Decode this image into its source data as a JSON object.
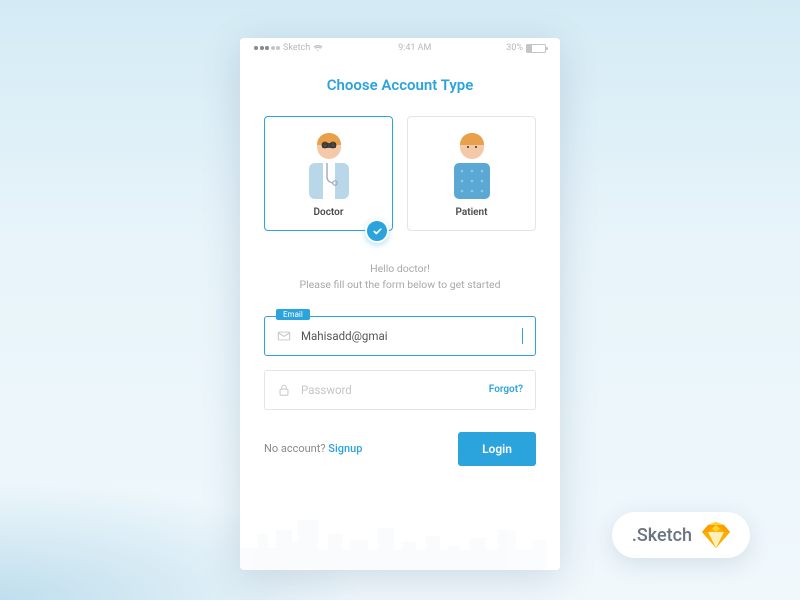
{
  "status": {
    "carrier": "Sketch",
    "time": "9:41 AM",
    "battery": "30%"
  },
  "title": "Choose Account Type",
  "accountTypes": {
    "doctor": "Doctor",
    "patient": "Patient"
  },
  "greeting": {
    "line1": "Hello doctor!",
    "line2": "Please fill out the form below to get started"
  },
  "email": {
    "label": "Email",
    "value": "Mahisadd@gmai"
  },
  "password": {
    "placeholder": "Password",
    "forgot": "Forgot?"
  },
  "footer": {
    "noAccount": "No account? ",
    "signup": "Signup",
    "login": "Login"
  },
  "badge": ".Sketch"
}
